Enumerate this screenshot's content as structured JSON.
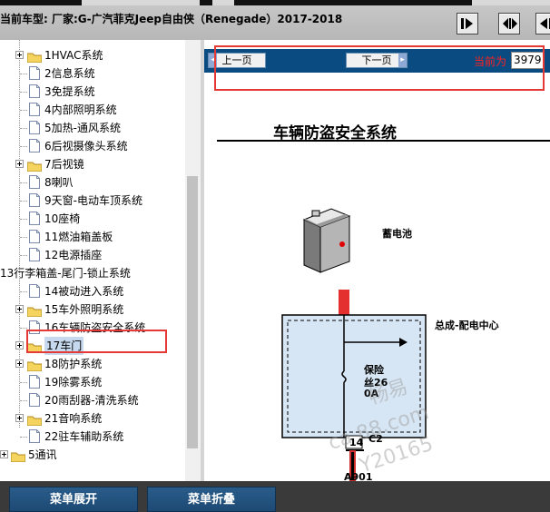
{
  "header": {
    "vehicle_text": "当前车型:   厂家:G-广汽菲克Jeep自由侠（Renegade）2017-2018",
    "buttons": [
      "nav-right-icon",
      "expand-both-icon",
      "nav-left-icon"
    ]
  },
  "tree": {
    "items": [
      {
        "label": "1HVAC系统",
        "type": "folder",
        "expandable": true
      },
      {
        "label": "2信息系统",
        "type": "doc"
      },
      {
        "label": "3免提系统",
        "type": "doc"
      },
      {
        "label": "4内部照明系统",
        "type": "doc"
      },
      {
        "label": "5加热-通风系统",
        "type": "doc"
      },
      {
        "label": "6后视摄像头系统",
        "type": "doc"
      },
      {
        "label": "7后视镜",
        "type": "folder",
        "expandable": true
      },
      {
        "label": "8喇叭",
        "type": "doc"
      },
      {
        "label": "9天窗-电动车顶系统",
        "type": "doc"
      },
      {
        "label": "10座椅",
        "type": "doc"
      },
      {
        "label": "11燃油箱盖板",
        "type": "doc"
      },
      {
        "label": "12电源插座",
        "type": "doc"
      },
      {
        "label": "13行李箱盖-尾门-锁止系统",
        "type": "plain"
      },
      {
        "label": "14被动进入系统",
        "type": "doc"
      },
      {
        "label": "15车外照明系统",
        "type": "folder",
        "expandable": true
      },
      {
        "label": "16车辆防盗安全系统",
        "type": "doc",
        "highlighted": true
      },
      {
        "label": "17车门",
        "type": "folder",
        "expandable": true,
        "selected": true
      },
      {
        "label": "18防护系统",
        "type": "folder",
        "expandable": true
      },
      {
        "label": "19除雾系统",
        "type": "doc"
      },
      {
        "label": "20雨刮器-清洗系统",
        "type": "doc"
      },
      {
        "label": "21音响系统",
        "type": "folder",
        "expandable": true
      },
      {
        "label": "22驻车辅助系统",
        "type": "doc"
      },
      {
        "label": "5通讯",
        "type": "folder",
        "expandable": true,
        "root": true
      }
    ]
  },
  "bottom": {
    "expand_label": "菜单展开",
    "collapse_label": "菜单折叠"
  },
  "pager": {
    "prev_label": "上一页",
    "next_label": "下一页",
    "current_label": "当前为",
    "page_value": "3979"
  },
  "document": {
    "title": "车辆防盗安全系统",
    "battery_label": "蓄电池",
    "junction_label": "总成-配电中心",
    "fuse_label_1": "保险",
    "fuse_label_2": "丝26",
    "fuse_label_3": "0A",
    "pin_label": "14",
    "connector_label": "C2",
    "wire_label": "A901"
  },
  "watermark": {
    "line1": "畅易",
    "line2": "ca    88.com",
    "line3": "Y20165"
  },
  "colors": {
    "header_bg": "#c0c0c0",
    "pager_bg": "#0a4c82",
    "highlight_red": "#e53935",
    "selected_bg": "#c7d9ee",
    "menu_button": "#1d4a74",
    "box_fill": "#d7e6f4"
  }
}
